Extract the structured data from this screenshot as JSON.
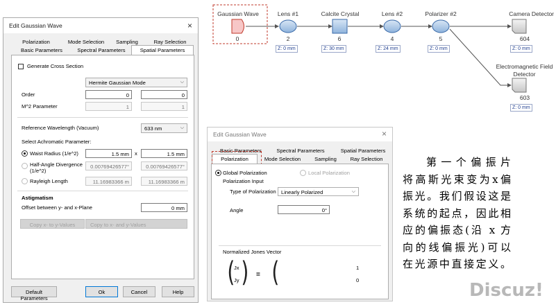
{
  "dialog1": {
    "title": "Edit Gaussian Wave",
    "close": "×",
    "tabs_back": [
      "Polarization",
      "Mode Selection",
      "Sampling",
      "Ray Selection"
    ],
    "tabs_front": [
      "Basic Parameters",
      "Spectral Parameters",
      "Spatial Parameters"
    ],
    "generate_cross_section": "Generate Cross Section",
    "mode_type": "Hermite Gaussian Mode",
    "order_label": "Order",
    "order_x": "0",
    "order_y": "0",
    "m2_label": "M^2 Parameter",
    "m2_x": "1",
    "m2_y": "1",
    "ref_wavelength_label": "Reference Wavelength (Vacuum)",
    "ref_wavelength": "633 nm",
    "achromatic_label": "Select Achromatic Parameter:",
    "waist_label": "Waist Radius (1/e^2)",
    "waist_x": "1.5 mm",
    "times": "x",
    "waist_y": "1.5 mm",
    "halfangle_label_1": "Half-Angle Divergence",
    "halfangle_label_2": "(1/e^2)",
    "halfangle_x": "0.00769426577°",
    "halfangle_y": "0.00769426577°",
    "rayleigh_label": "Rayleigh Length",
    "rayleigh_x": "11.16983366 m",
    "rayleigh_y": "11.16983366 m",
    "astigmatism_label": "Astigmatism",
    "offset_label": "Offset between y- and x-Plane",
    "offset_value": "0 mm",
    "copy_btn_1": "Copy x- to y-Values",
    "copy_btn_2": "Copy to x- and y-Values",
    "btn_default": "Default Parameters",
    "btn_ok": "Ok",
    "btn_cancel": "Cancel",
    "btn_help": "Help"
  },
  "diagram": {
    "nodes": [
      {
        "label": "Gaussian Wave",
        "num": "0"
      },
      {
        "label": "Lens #1",
        "num": "2",
        "z": "Z: 0 mm"
      },
      {
        "label": "Calcite Crystal",
        "num": "6",
        "z": "Z: 30 mm"
      },
      {
        "label": "Lens #2",
        "num": "4",
        "z": "Z: 24 mm"
      },
      {
        "label": "Polarizer #2",
        "num": "5",
        "z": "Z: 0 mm"
      },
      {
        "label": "Camera Detector",
        "num": "604",
        "z": "Z: 0 mm"
      }
    ],
    "em_detector": {
      "label_1": "Electromagnetic Field",
      "label_2": "Detector",
      "num": "603",
      "z": "Z: 0 mm"
    }
  },
  "dialog2": {
    "title": "Edit Gaussian Wave",
    "close": "×",
    "tabs_back": [
      "Basic Parameters",
      "Spectral Parameters",
      "Spatial Parameters"
    ],
    "tabs_front": [
      "Polarization",
      "Mode Selection",
      "Sampling",
      "Ray Selection"
    ],
    "global_polarization": "Global Polarization",
    "local_polarization": "Local Polarization",
    "polarization_input": "Polarization Input",
    "type_label": "Type of Polarization",
    "type_value": "Linearly Polarized",
    "angle_label": "Angle",
    "angle_value": "0°",
    "jones_label": "Normalized Jones Vector",
    "jx": "Jx",
    "jy": "Jy",
    "equals": "=",
    "v1": "1",
    "v2": "0"
  },
  "chinese_text": [
    "第一个偏振片",
    "将高斯光束变为x偏",
    "振光。我们假设这是",
    "系统的起点，因此相",
    "应的偏振态(沿 x 方",
    "向的线偏振光)可以",
    "在光源中直接定义。"
  ],
  "watermark": "Discuz!"
}
